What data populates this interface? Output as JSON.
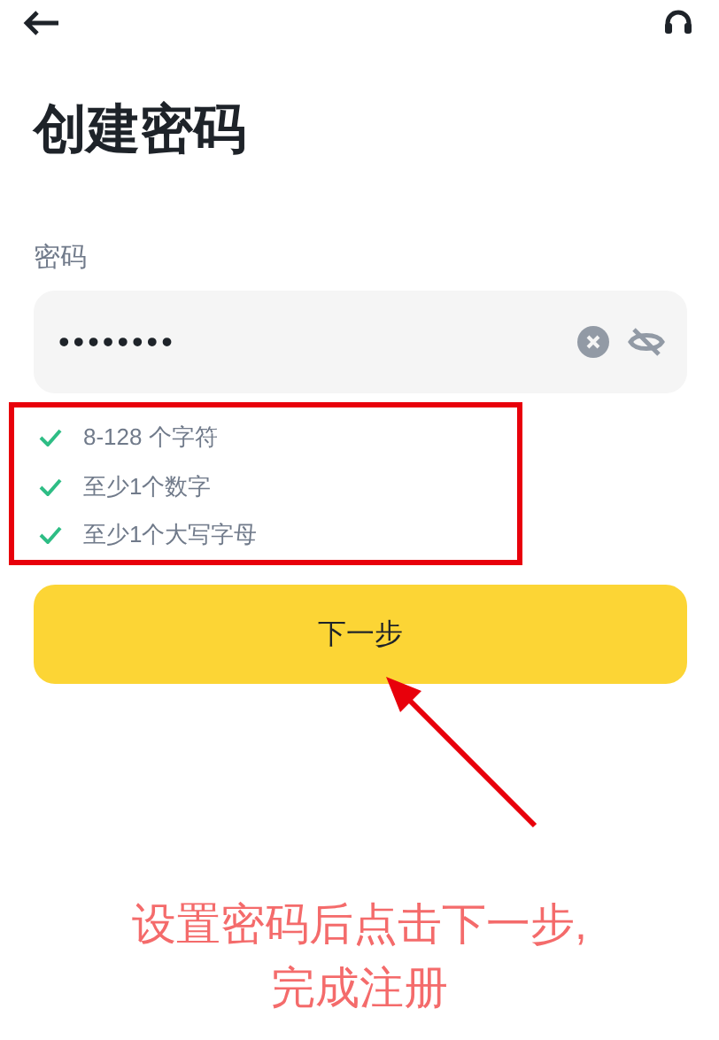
{
  "header": {
    "title": "创建密码"
  },
  "password_field": {
    "label": "密码",
    "value": "••••••••",
    "masked": true
  },
  "rules": [
    {
      "text": "8-128 个字符",
      "met": true
    },
    {
      "text": "至少1个数字",
      "met": true
    },
    {
      "text": "至少1个大写字母",
      "met": true
    }
  ],
  "next_button": {
    "label": "下一步"
  },
  "annotation": {
    "caption": [
      "设置密码后点击下一步,",
      "完成注册"
    ]
  }
}
